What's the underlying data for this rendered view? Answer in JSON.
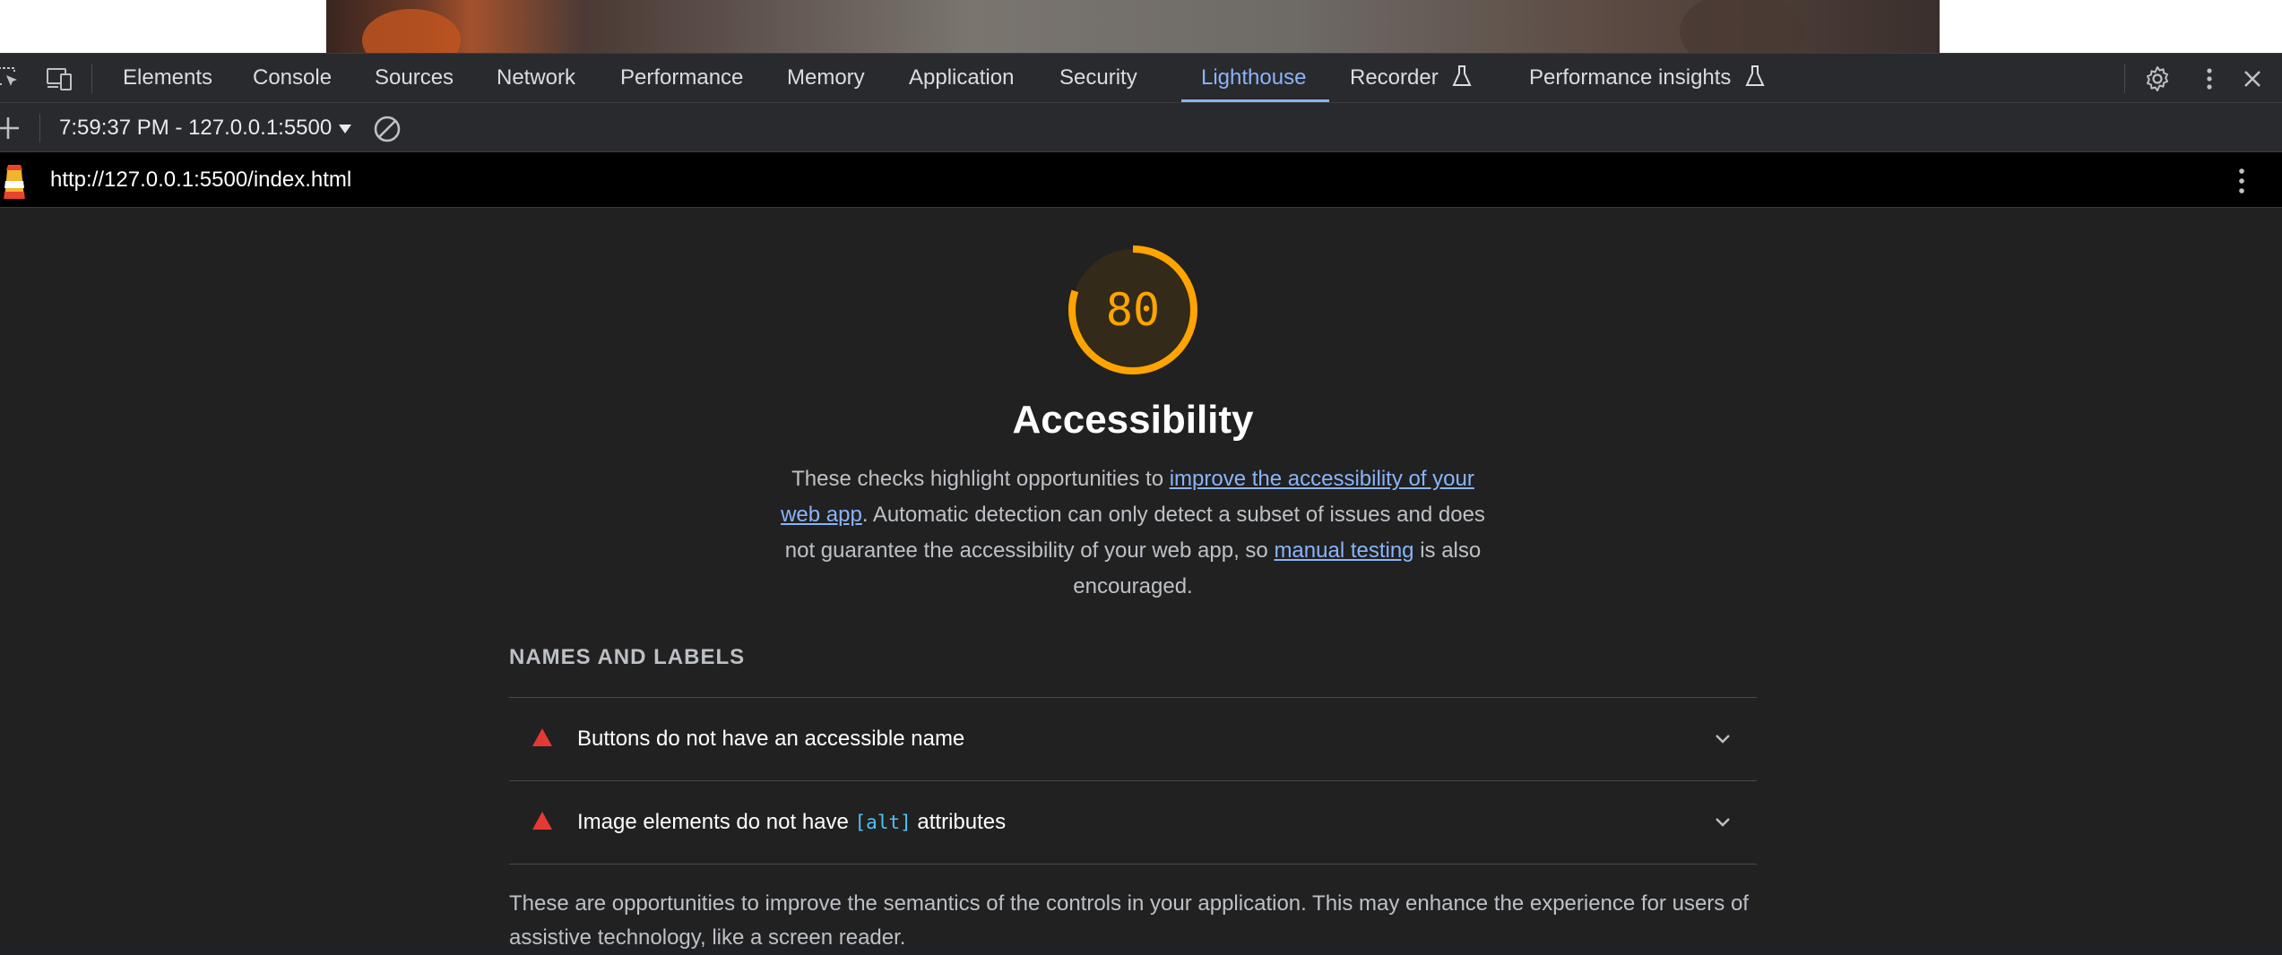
{
  "devtools": {
    "tabs": [
      {
        "label": "Elements"
      },
      {
        "label": "Console"
      },
      {
        "label": "Sources"
      },
      {
        "label": "Network"
      },
      {
        "label": "Performance"
      },
      {
        "label": "Memory"
      },
      {
        "label": "Application"
      },
      {
        "label": "Security"
      },
      {
        "label": "Lighthouse",
        "active": true
      },
      {
        "label": "Recorder"
      },
      {
        "label": "Performance insights"
      }
    ],
    "active_tab": "Lighthouse",
    "accent_color": "#8ab4f8"
  },
  "lighthouse": {
    "session_label": "7:59:37 PM - 127.0.0.1:5500",
    "url": "http://127.0.0.1:5500/index.html"
  },
  "report": {
    "score": "80",
    "score_fraction": 0.8,
    "score_color": "#ffa400",
    "category_title": "Accessibility",
    "description": {
      "part1": "These checks highlight opportunities to ",
      "link1": "improve the accessibility of your web app",
      "part2": ". Automatic detection can only detect a subset of issues and does not guarantee the accessibility of your web app, so ",
      "link2": "manual testing",
      "part3": " is also encouraged."
    },
    "group_title": "NAMES AND LABELS",
    "audits": [
      {
        "label": "Buttons do not have an accessible name"
      },
      {
        "label_before": "Image elements do not have ",
        "code": "[alt]",
        "label_after": " attributes"
      }
    ],
    "group_description": "These are opportunities to improve the semantics of the controls in your application. This may enhance the experience for users of assistive technology, like a screen reader."
  }
}
